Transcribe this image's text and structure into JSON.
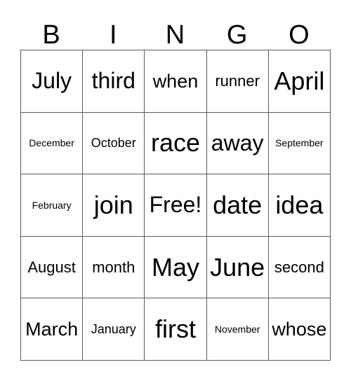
{
  "card": {
    "header_letters": [
      "B",
      "I",
      "N",
      "G",
      "O"
    ],
    "rows": [
      [
        {
          "text": "July",
          "size": "xl"
        },
        {
          "text": "third",
          "size": "xl"
        },
        {
          "text": "when",
          "size": "l"
        },
        {
          "text": "runner",
          "size": "m"
        },
        {
          "text": "April",
          "size": "xxl"
        }
      ],
      [
        {
          "text": "December",
          "size": "xs"
        },
        {
          "text": "October",
          "size": "s"
        },
        {
          "text": "race",
          "size": "xxl"
        },
        {
          "text": "away",
          "size": "xl"
        },
        {
          "text": "September",
          "size": "xs"
        }
      ],
      [
        {
          "text": "February",
          "size": "xs"
        },
        {
          "text": "join",
          "size": "xxl"
        },
        {
          "text": "Free!",
          "size": "xl"
        },
        {
          "text": "date",
          "size": "xxl"
        },
        {
          "text": "idea",
          "size": "xxl"
        }
      ],
      [
        {
          "text": "August",
          "size": "m"
        },
        {
          "text": "month",
          "size": "m"
        },
        {
          "text": "May",
          "size": "xxl"
        },
        {
          "text": "June",
          "size": "xxl"
        },
        {
          "text": "second",
          "size": "m"
        }
      ],
      [
        {
          "text": "March",
          "size": "l"
        },
        {
          "text": "January",
          "size": "s"
        },
        {
          "text": "first",
          "size": "xxl"
        },
        {
          "text": "November",
          "size": "xs"
        },
        {
          "text": "whose",
          "size": "l"
        }
      ]
    ],
    "free_space": {
      "row": 2,
      "column": 2,
      "label": "Free!"
    },
    "colors": {
      "background": "#ffffff",
      "text": "#000000",
      "grid_line": "#5a5a5a",
      "grid_outer": "#3a3a3a"
    }
  }
}
